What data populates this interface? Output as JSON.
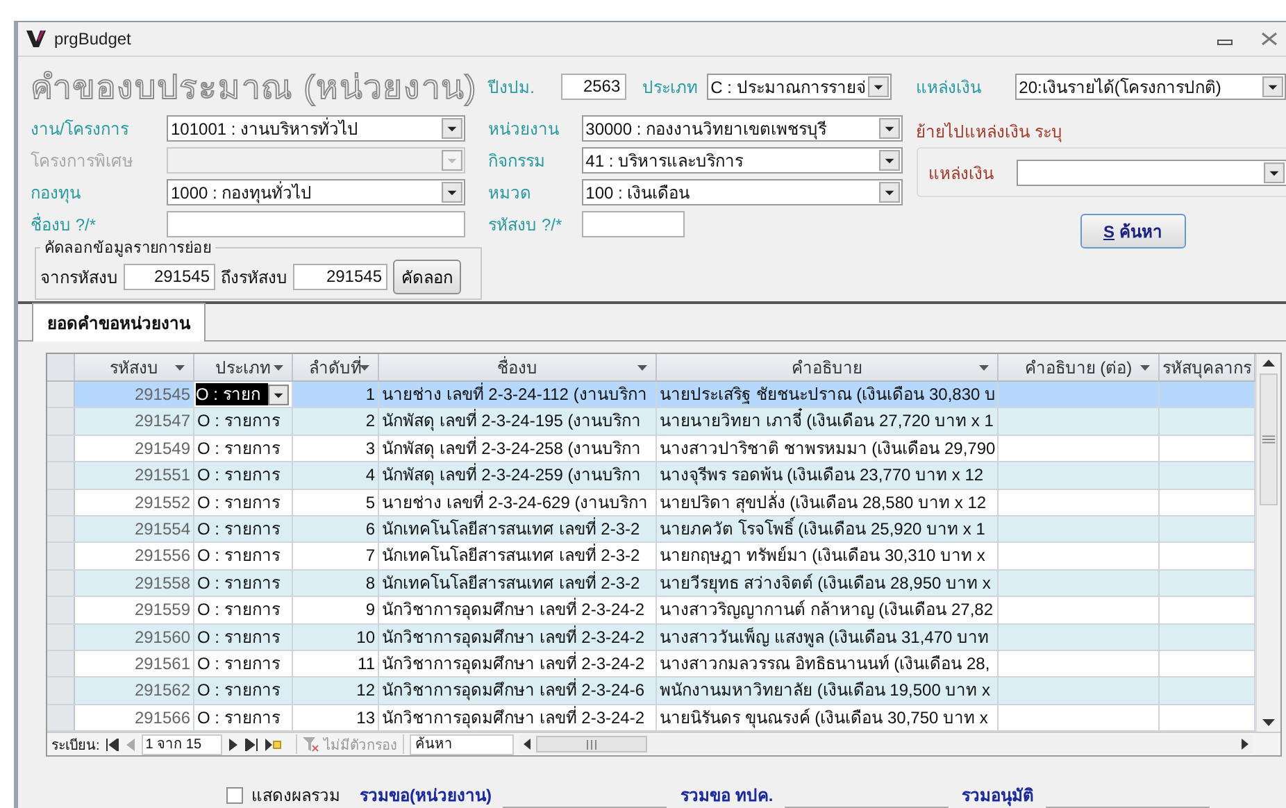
{
  "window": {
    "title": "prgBudget"
  },
  "form": {
    "title": "คำของบประมาณ (หน่วยงาน)",
    "year": {
      "label": "ปีงปม.",
      "value": "2563"
    },
    "budget_type": {
      "label": "ประเภท",
      "value": "C : ประมาณการรายจ่"
    },
    "fund_source": {
      "label": "แหล่งเงิน",
      "value": "20:เงินรายได้(โครงการปกติ)"
    },
    "left": [
      {
        "label": "งาน/โครงการ",
        "value": "101001 : งานบริหารทั่วไป",
        "kind": "select",
        "disabled": false
      },
      {
        "label": "โครงการพิเศษ",
        "kind": "select",
        "disabled": true
      },
      {
        "label": "กองทุน",
        "value": "1000 : กองทุนทั่วไป",
        "kind": "select",
        "disabled": false
      },
      {
        "label": "ชื่องบ ?/*",
        "kind": "text",
        "disabled": false
      }
    ],
    "middle": [
      {
        "label": "หน่วยงาน",
        "value": "30000 : กองงานวิทยาเขตเพชรบุรี",
        "kind": "select",
        "disabled": false
      },
      {
        "label": "กิจกรรม",
        "value": "41 : บริหารและบริการ",
        "kind": "select",
        "disabled": false
      },
      {
        "label": "หมวด",
        "value": "100 : เงินเดือน",
        "kind": "select",
        "disabled": false
      },
      {
        "label": "รหัสงบ ?/*",
        "kind": "text",
        "disabled": false
      }
    ],
    "move_group": {
      "title": "ย้ายไปแหล่งเงิน ระบุ",
      "label": "แหล่งเงิน"
    },
    "search_button": {
      "key": "S",
      "label": "ค้นหา"
    },
    "copy_group": {
      "title": "คัดลอกข้อมูลรายการย่อย",
      "from_label": "จากรหัสงบ",
      "from_value": "291545",
      "to_label": "ถึงรหัสงบ",
      "to_value": "291545",
      "button": "คัดลอก"
    }
  },
  "tabs": [
    {
      "label": "ยอดคำขอหน่วยงาน",
      "selected": true
    }
  ],
  "table": {
    "columns": [
      {
        "label": "รหัสงบ",
        "menu": true
      },
      {
        "label": "ประเภท",
        "menu": true
      },
      {
        "label": "ลำดับที่",
        "menu": true
      },
      {
        "label": "ชื่องบ",
        "menu": true
      },
      {
        "label": "คำอธิบาย",
        "menu": true
      },
      {
        "label": "คำอธิบาย (ต่อ)",
        "menu": true
      },
      {
        "label": "รหัสบุคลากร",
        "menu": false
      }
    ],
    "rows": [
      {
        "id": "291545",
        "type": "O : รายก",
        "order": "1",
        "name": "นายช่าง เลขที่ 2-3-24-112 (งานบริกา",
        "description": "นายประเสริฐ ชัยชนะปราณ (เงินเดือน 30,830 บ",
        "selected": true
      },
      {
        "id": "291547",
        "type": "O : รายการ",
        "order": "2",
        "name": "นักพัสดุ เลขที่ 2-3-24-195 (งานบริกา",
        "description": "นายนายวิทยา เภาจี๋ (เงินเดือน 27,720 บาท x 1",
        "selected": false
      },
      {
        "id": "291549",
        "type": "O : รายการ",
        "order": "3",
        "name": "นักพัสดุ เลขที่ 2-3-24-258 (งานบริกา",
        "description": "นางสาวปาริชาติ ชาพรหมมา (เงินเดือน 29,790",
        "selected": false
      },
      {
        "id": "291551",
        "type": "O : รายการ",
        "order": "4",
        "name": "นักพัสดุ เลขที่ 2-3-24-259 (งานบริกา",
        "description": "นางจุรีพร รอดพ้น (เงินเดือน 23,770 บาท x 12",
        "selected": false
      },
      {
        "id": "291552",
        "type": "O : รายการ",
        "order": "5",
        "name": "นายช่าง เลขที่ 2-3-24-629 (งานบริกา",
        "description": "นายปริดา สุขปลั่ง (เงินเดือน 28,580 บาท x 12",
        "selected": false
      },
      {
        "id": "291554",
        "type": "O : รายการ",
        "order": "6",
        "name": "นักเทคโนโลยีสารสนเทศ เลขที่ 2-3-2",
        "description": "นายภควัต โรจโพธิ์ (เงินเดือน 25,920 บาท x 1",
        "selected": false
      },
      {
        "id": "291556",
        "type": "O : รายการ",
        "order": "7",
        "name": "นักเทคโนโลยีสารสนเทศ เลขที่ 2-3-2",
        "description": "นายกฤษฎา ทรัพย์มา (เงินเดือน 30,310 บาท x",
        "selected": false
      },
      {
        "id": "291558",
        "type": "O : รายการ",
        "order": "8",
        "name": "นักเทคโนโลยีสารสนเทศ เลขที่ 2-3-2",
        "description": "นายวีรยุทธ สว่างจิตต์ (เงินเดือน 28,950 บาท x",
        "selected": false
      },
      {
        "id": "291559",
        "type": "O : รายการ",
        "order": "9",
        "name": "นักวิชาการอุดมศึกษา เลขที่ 2-3-24-2",
        "description": "นางสาวริญญากานต์ กล้าหาญ (เงินเดือน 27,82",
        "selected": false
      },
      {
        "id": "291560",
        "type": "O : รายการ",
        "order": "10",
        "name": "นักวิชาการอุดมศึกษา เลขที่ 2-3-24-2",
        "description": "นางสาววันเพ็ญ  แสงพูล (เงินเดือน 31,470 บาท",
        "selected": false
      },
      {
        "id": "291561",
        "type": "O : รายการ",
        "order": "11",
        "name": "นักวิชาการอุดมศึกษา เลขที่ 2-3-24-2",
        "description": "นางสาวกมลวรรณ  อิทธิธนานนท์ (เงินเดือน 28,",
        "selected": false
      },
      {
        "id": "291562",
        "type": "O : รายการ",
        "order": "12",
        "name": "นักวิชาการอุดมศึกษา เลขที่ 2-3-24-6",
        "description": "พนักงานมหาวิทยาลัย (เงินเดือน 19,500 บาท x",
        "selected": false
      },
      {
        "id": "291566",
        "type": "O : รายการ",
        "order": "13",
        "name": "นักวิชาการอุดมศึกษา เลขที่ 2-3-24-2",
        "description": "นายนิรันดร ขุนณรงค์ (เงินเดือน 30,750 บาท x",
        "selected": false
      }
    ]
  },
  "navigator": {
    "label": "ระเบียน:",
    "position": "1 จาก 15",
    "filter": "ไม่มีตัวกรอง",
    "search_placeholder": "ค้นหา"
  },
  "footer": {
    "show_total": {
      "label": "แสดงผลรวม",
      "checked": false
    },
    "totals": [
      {
        "label": "รวมขอ(หน่วยงาน)"
      },
      {
        "label": "รวมขอ ทปค."
      },
      {
        "label": "รวมอนุมัติ"
      }
    ]
  }
}
